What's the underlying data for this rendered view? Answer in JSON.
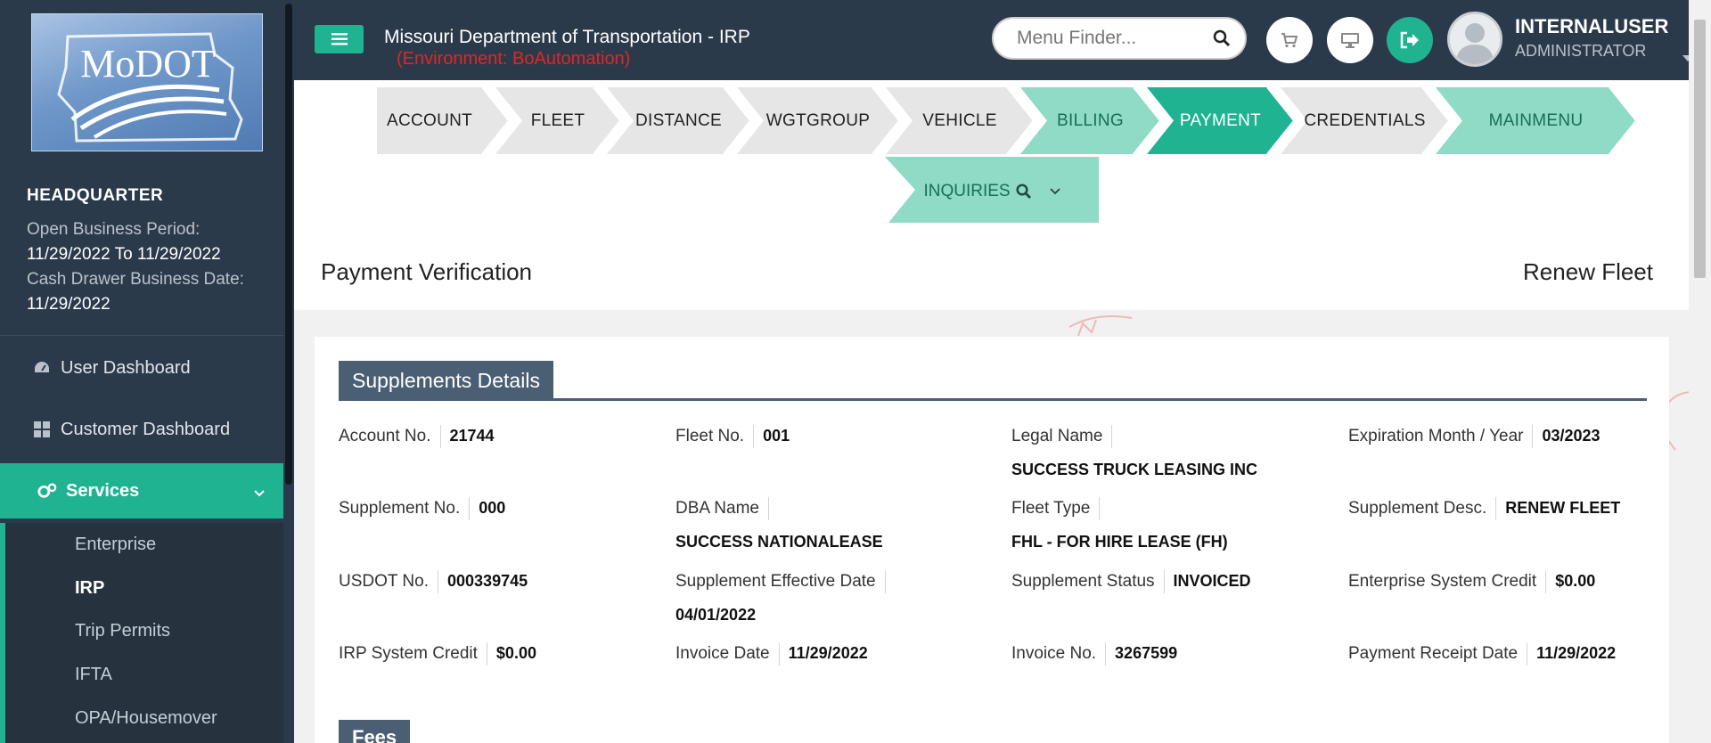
{
  "sidebar": {
    "logo_text": "MoDOT",
    "hq_title": "HEADQUARTER",
    "open_period_label": "Open Business Period:",
    "open_period_from": "11/29/2022",
    "open_period_to_word": "To",
    "open_period_to": "11/29/2022",
    "cash_drawer_label": "Cash Drawer Business Date:",
    "cash_drawer_date": "11/29/2022",
    "nav": [
      {
        "label": "User Dashboard",
        "icon": "dashboard-icon"
      },
      {
        "label": "Customer Dashboard",
        "icon": "grid-icon"
      },
      {
        "label": "Services",
        "icon": "gears-icon"
      }
    ],
    "services_sub": [
      "Enterprise",
      "IRP",
      "Trip Permits",
      "IFTA",
      "OPA/Housemover"
    ]
  },
  "header": {
    "title": "Missouri Department of Transportation - IRP",
    "environment": "(Environment: BoAutomation)",
    "menu_finder_placeholder": "Menu Finder...",
    "user_name": "INTERNALUSER",
    "user_role": "ADMINISTRATOR"
  },
  "wizard": {
    "steps": [
      "ACCOUNT",
      "FLEET",
      "DISTANCE",
      "WGTGROUP",
      "VEHICLE",
      "BILLING",
      "PAYMENT",
      "CREDENTIALS",
      "MAINMENU"
    ],
    "inquiries": "INQUIRIES"
  },
  "page": {
    "title": "Payment Verification",
    "mode": "Renew Fleet",
    "section_title": "Supplements Details",
    "fees_title": "Fees"
  },
  "details": {
    "account_no_label": "Account No.",
    "account_no": "21744",
    "fleet_no_label": "Fleet No.",
    "fleet_no": "001",
    "legal_name_label": "Legal Name",
    "legal_name": "SUCCESS TRUCK LEASING INC",
    "expiration_label": "Expiration Month / Year",
    "expiration": "03/2023",
    "supplement_no_label": "Supplement No.",
    "supplement_no": "000",
    "dba_name_label": "DBA Name",
    "dba_name": "SUCCESS NATIONALEASE",
    "fleet_type_label": "Fleet Type",
    "fleet_type": "FHL - FOR HIRE LEASE (FH)",
    "supplement_desc_label": "Supplement Desc.",
    "supplement_desc": "RENEW FLEET",
    "usdot_label": "USDOT No.",
    "usdot": "000339745",
    "effective_date_label": "Supplement Effective Date",
    "effective_date": "04/01/2022",
    "status_label": "Supplement Status",
    "status": "INVOICED",
    "enterprise_credit_label": "Enterprise System Credit",
    "enterprise_credit": "$0.00",
    "irp_credit_label": "IRP System Credit",
    "irp_credit": "$0.00",
    "invoice_date_label": "Invoice Date",
    "invoice_date": "11/29/2022",
    "invoice_no_label": "Invoice No.",
    "invoice_no": "3267599",
    "receipt_date_label": "Payment Receipt Date",
    "receipt_date": "11/29/2022"
  },
  "colors": {
    "sidebar_bg": "#2b3a4a",
    "accent": "#1fb392",
    "step_grey": "#e6e6e6",
    "step_light": "#8fdbc6",
    "step_active": "#1fb392",
    "section_header": "#4b5f74",
    "env_red": "#e02626"
  }
}
